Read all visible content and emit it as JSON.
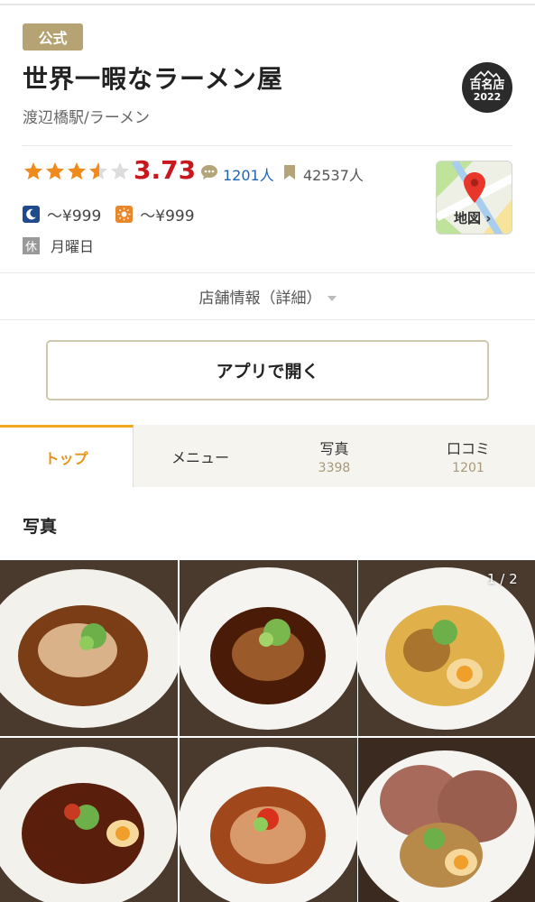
{
  "header": {
    "official_badge": "公式",
    "shop_name": "世界一暇なラーメン屋",
    "station_genre": "渡辺橋駅/ラーメン",
    "award_name": "百名店",
    "award_year": "2022"
  },
  "rating": {
    "stars": 3.73,
    "score": "3.73",
    "review_count": "1201人",
    "bookmark_count": "42537人",
    "star_color": "#f08a1c",
    "score_color": "#c9171e"
  },
  "map": {
    "label": "地図"
  },
  "prices": {
    "dinner": "～¥999",
    "lunch": "～¥999",
    "dinner_icon": "moon-icon",
    "lunch_icon": "sun-icon"
  },
  "holiday": {
    "icon_label": "休",
    "text": "月曜日"
  },
  "details_link": "店舗情報（詳細）",
  "open_app_button": "アプリで開く",
  "tabs": [
    {
      "label": "トップ",
      "count": ""
    },
    {
      "label": "メニュー",
      "count": ""
    },
    {
      "label": "写真",
      "count": "3398"
    },
    {
      "label": "口コミ",
      "count": "1201"
    }
  ],
  "photos_section": {
    "title": "写真",
    "pager": "1 / 2"
  },
  "colors": {
    "accent": "#f2a91e",
    "badge": "#b5a373",
    "link": "#1f64b4"
  }
}
